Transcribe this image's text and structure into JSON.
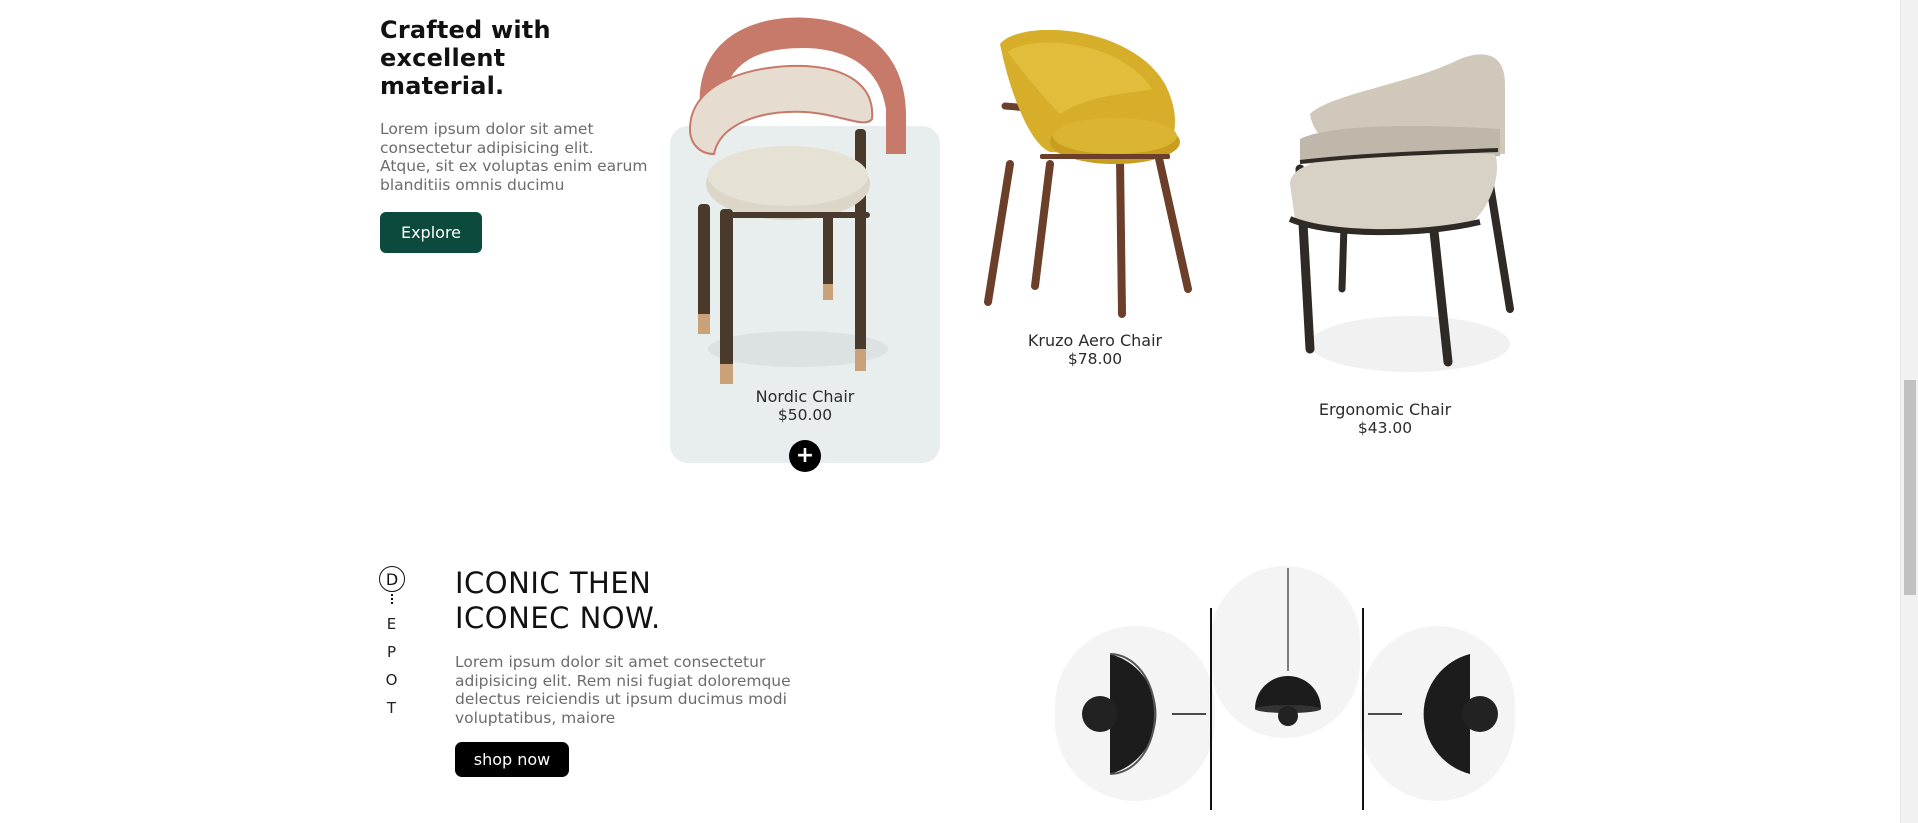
{
  "intro": {
    "heading_line1": "Crafted with",
    "heading_line2": "excellent",
    "heading_line3": "material.",
    "body": "Lorem ipsum dolor sit amet consectetur adipisicing elit. Atque, sit ex voluptas enim earum blanditiis omnis ducimu",
    "explore_label": "Explore"
  },
  "products": [
    {
      "name": "Nordic Chair",
      "price": "$50.00"
    },
    {
      "name": "Kruzo Aero Chair",
      "price": "$78.00"
    },
    {
      "name": "Ergonomic Chair",
      "price": "$43.00"
    }
  ],
  "add_icon": "+",
  "brand": {
    "logo_letter": "D",
    "letters": [
      "E",
      "P",
      "O",
      "T"
    ]
  },
  "iconic": {
    "heading_line1": "ICONIC THEN",
    "heading_line2": "ICONEC NOW.",
    "body": "Lorem ipsum dolor sit amet consectetur adipisicing elit. Rem nisi fugiat doloremque delectus reiciendis ut ipsum ducimus modi voluptatibus, maiore",
    "shop_label": "shop now"
  },
  "colors": {
    "accent_green": "#0b4a3c",
    "card_bg": "#e7eeed",
    "black_button": "#000000"
  }
}
